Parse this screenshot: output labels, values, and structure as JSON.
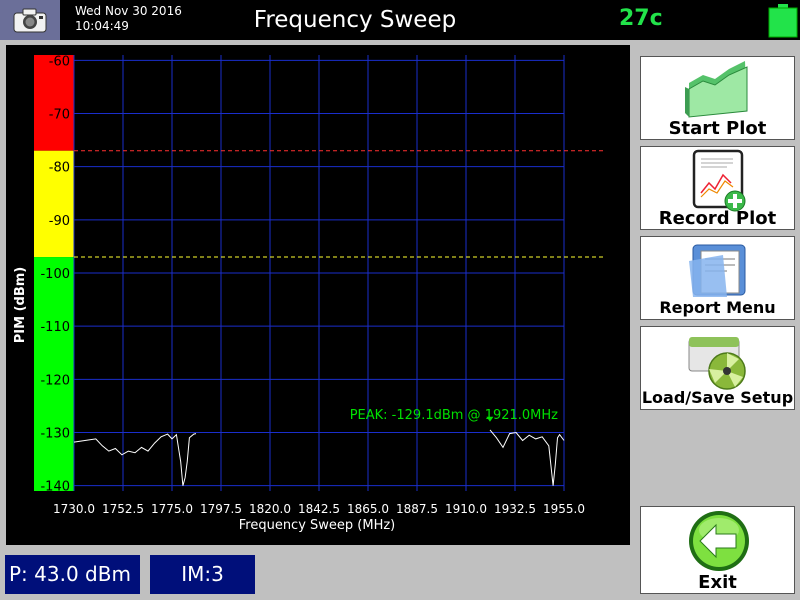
{
  "header": {
    "date": "Wed Nov 30 2016",
    "time": "10:04:49",
    "title": "Frequency Sweep",
    "temperature": "27c",
    "camera_icon": "camera-icon",
    "battery_icon": "battery-icon"
  },
  "colors": {
    "plot_bg": "#000000",
    "grid": "#1a2ecc",
    "trace": "#ffffff",
    "red_zone": "#ff0000",
    "yellow_zone": "#ffff00",
    "green_zone": "#00ff00",
    "peak_text": "#00e000",
    "status_bg": "#000f7a"
  },
  "chart_data": {
    "type": "line",
    "xlabel": "Frequency Sweep (MHz)",
    "ylabel": "PIM (dBm)",
    "xlim": [
      1730.0,
      1955.0
    ],
    "ylim": [
      -141,
      -59
    ],
    "x_ticks": [
      "1730.0",
      "1752.5",
      "1775.0",
      "1797.5",
      "1820.0",
      "1842.5",
      "1865.0",
      "1887.5",
      "1910.0",
      "1932.5",
      "1955.0"
    ],
    "y_ticks": [
      "-60",
      "-70",
      "-80",
      "-90",
      "-100",
      "-110",
      "-120",
      "-130",
      "-140"
    ],
    "zones": [
      {
        "from": -59,
        "to": -77,
        "color": "#ff0000"
      },
      {
        "from": -77,
        "to": -97,
        "color": "#ffff00"
      },
      {
        "from": -97,
        "to": -141,
        "color": "#00ff00"
      }
    ],
    "thresholds": [
      {
        "value": -77,
        "color": "#ff3030"
      },
      {
        "value": -97,
        "color": "#ffff30"
      }
    ],
    "peak_label": "PEAK: -129.1dBm @ 1921.0MHz",
    "peak": {
      "x": 1921.0,
      "y": -129.1
    },
    "series": [
      {
        "values_x": [
          1730,
          1735,
          1740,
          1743,
          1746,
          1749,
          1752,
          1755,
          1758,
          1761,
          1764,
          1767,
          1770,
          1773,
          1775,
          1777,
          1779,
          1780,
          1781,
          1782,
          1783,
          1785,
          1786
        ],
        "values_y": [
          -131.8,
          -131.5,
          -131.2,
          -132.5,
          -133.5,
          -133.0,
          -134.2,
          -133.5,
          -133.8,
          -132.8,
          -133.5,
          -132.0,
          -130.8,
          -130.3,
          -131.2,
          -130.4,
          -135.5,
          -140.0,
          -138.5,
          -135.5,
          -131.0,
          -130.3,
          -130.2
        ]
      },
      {
        "values_x": [
          1921,
          1924,
          1927,
          1930,
          1933,
          1936,
          1939,
          1942,
          1945,
          1948,
          1950,
          1951,
          1952,
          1953,
          1955
        ],
        "values_y": [
          -129.5,
          -131.0,
          -132.8,
          -130.2,
          -130.0,
          -131.5,
          -130.5,
          -131.2,
          -130.8,
          -132.5,
          -140.0,
          -136.0,
          -131.0,
          -130.4,
          -131.5
        ]
      }
    ]
  },
  "buttons": {
    "start_plot": "Start Plot",
    "record_plot": "Record Plot",
    "report_menu": "Report Menu",
    "load_save_setup": "Load/Save Setup",
    "exit": "Exit"
  },
  "status": {
    "power": "P: 43.0 dBm",
    "im": "IM:3"
  }
}
